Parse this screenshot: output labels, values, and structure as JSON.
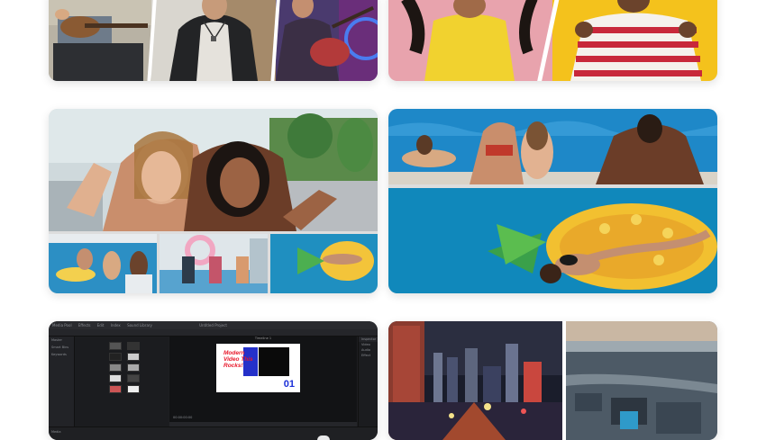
{
  "gallery": {
    "cards": [
      {
        "name": "card-musicians",
        "alt": "Musicians collage"
      },
      {
        "name": "card-dancers",
        "alt": "Dancers collage"
      },
      {
        "name": "card-pool-friends",
        "alt": "Pool party collage"
      },
      {
        "name": "card-swimmers",
        "alt": "Swimmers collage"
      },
      {
        "name": "card-video-editor",
        "alt": "Video editor screenshot"
      },
      {
        "name": "card-city",
        "alt": "City night collage"
      }
    ]
  },
  "editor": {
    "menu": [
      "Media Pool",
      "Effects",
      "Edit",
      "Index",
      "Sound Library"
    ],
    "project_title": "Untitled Project",
    "viewer_label": "Timeline 1",
    "timecode": "00:00:00:00",
    "left_panel": [
      "Master",
      "Smart Bins",
      "Keywords"
    ],
    "right_panel_header": "Inspector",
    "right_panel_rows": [
      "Video",
      "Audio",
      "Effect"
    ],
    "slide_title": "Modern Video This Rocks!",
    "slide_number": "01",
    "bottom_label": "Media"
  },
  "colors": {
    "yellow_bg": "#f4c21c",
    "pink_bg": "#e8a3ad",
    "pool_blue": "#1c8dc4",
    "slide_red": "#e8172a",
    "slide_blue": "#2430c9"
  }
}
